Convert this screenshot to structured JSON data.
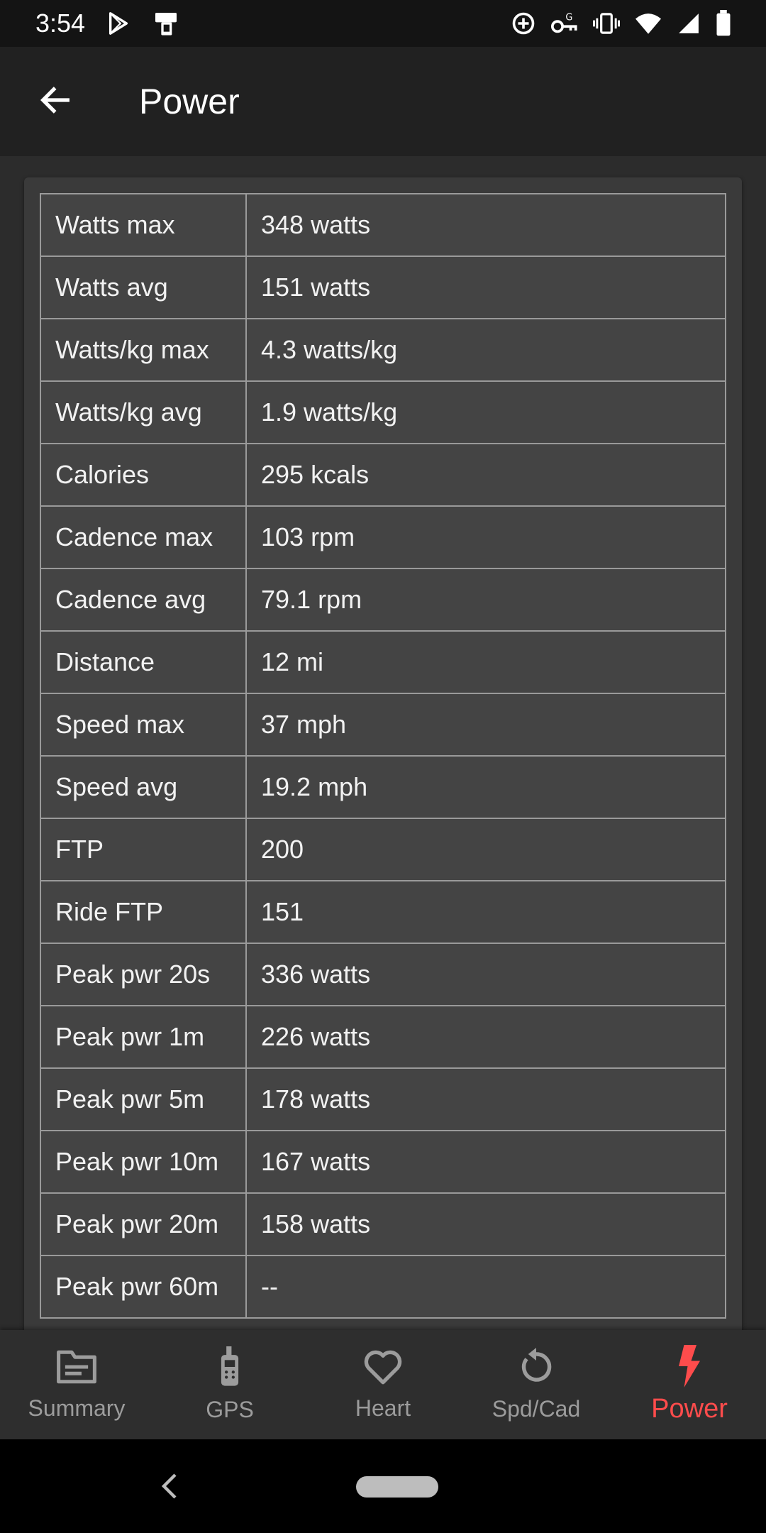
{
  "status_bar": {
    "time": "3:54",
    "left_icons": [
      "play-store-icon",
      "device-icon"
    ],
    "right_icons": [
      "data-saver-icon",
      "vpn-key-icon",
      "vibrate-icon",
      "wifi-icon",
      "cell-signal-icon",
      "battery-icon"
    ]
  },
  "app_bar": {
    "title": "Power",
    "back_icon": "arrow-back-icon"
  },
  "stats": [
    {
      "label": "Watts max",
      "value": "348 watts"
    },
    {
      "label": "Watts avg",
      "value": "151 watts"
    },
    {
      "label": "Watts/kg max",
      "value": "4.3 watts/kg"
    },
    {
      "label": "Watts/kg avg",
      "value": "1.9 watts/kg"
    },
    {
      "label": "Calories",
      "value": "295 kcals"
    },
    {
      "label": "Cadence max",
      "value": "103 rpm"
    },
    {
      "label": "Cadence avg",
      "value": "79.1 rpm"
    },
    {
      "label": "Distance",
      "value": "12 mi"
    },
    {
      "label": "Speed max",
      "value": "37 mph"
    },
    {
      "label": "Speed avg",
      "value": "19.2 mph"
    },
    {
      "label": "FTP",
      "value": "200"
    },
    {
      "label": "Ride FTP",
      "value": "151"
    },
    {
      "label": "Peak pwr 20s",
      "value": "336 watts"
    },
    {
      "label": "Peak pwr 1m",
      "value": "226 watts"
    },
    {
      "label": "Peak pwr 5m",
      "value": "178 watts"
    },
    {
      "label": "Peak pwr 10m",
      "value": "167 watts"
    },
    {
      "label": "Peak pwr 20m",
      "value": "158 watts"
    },
    {
      "label": "Peak pwr 60m",
      "value": "--"
    }
  ],
  "bottom_nav": {
    "items": [
      {
        "label": "Summary",
        "icon": "summary-icon"
      },
      {
        "label": "GPS",
        "icon": "gps-device-icon"
      },
      {
        "label": "Heart",
        "icon": "heart-icon"
      },
      {
        "label": "Spd/Cad",
        "icon": "refresh-icon"
      },
      {
        "label": "Power",
        "icon": "lightning-icon"
      }
    ],
    "active": "Power"
  },
  "colors": {
    "accent": "#ff4c4c",
    "app_bar": "#212121",
    "background": "#2c2c2c",
    "table_cell": "#444444",
    "table_border": "#9a9a9a",
    "nav_inactive": "#9c9c9c"
  }
}
